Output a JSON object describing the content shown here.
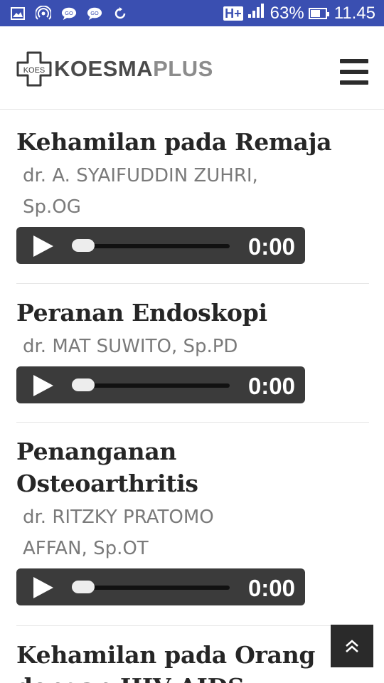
{
  "status_bar": {
    "network": "H+",
    "battery": "63%",
    "battery_level": 0.63,
    "time": "11.45",
    "icons": [
      "gallery-icon",
      "hotspot-icon",
      "chat-icon",
      "chat-icon",
      "sync-icon"
    ]
  },
  "header": {
    "logo_badge": "KOES",
    "logo_part1": "KOESMA",
    "logo_part2": "PLUS",
    "menu_icon": "hamburger-menu-icon"
  },
  "articles": [
    {
      "title": "Kehamilan pada Remaja",
      "author_lines": [
        "dr. A. SYAIFUDDIN ZUHRI,",
        "Sp.OG"
      ],
      "time": "0:00",
      "progress": 0
    },
    {
      "title": "Peranan Endoskopi",
      "author_lines": [
        "dr. MAT SUWITO, Sp.PD"
      ],
      "time": "0:00",
      "progress": 0
    },
    {
      "title_lines": [
        "Penanganan",
        "Osteoarthritis"
      ],
      "author_lines": [
        "dr. RITZKY PRATOMO",
        "AFFAN, Sp.OT"
      ],
      "time": "0:00",
      "progress": 0
    },
    {
      "title_lines": [
        "Kehamilan pada Orang",
        "dengan HIV-AIDS"
      ]
    }
  ],
  "back_to_top_icon": "double-chevron-up-icon",
  "colors": {
    "status_bar": "#3a4fb1",
    "player_bg": "#3b3b3b",
    "title": "#262626",
    "author": "#7a7a7a"
  }
}
